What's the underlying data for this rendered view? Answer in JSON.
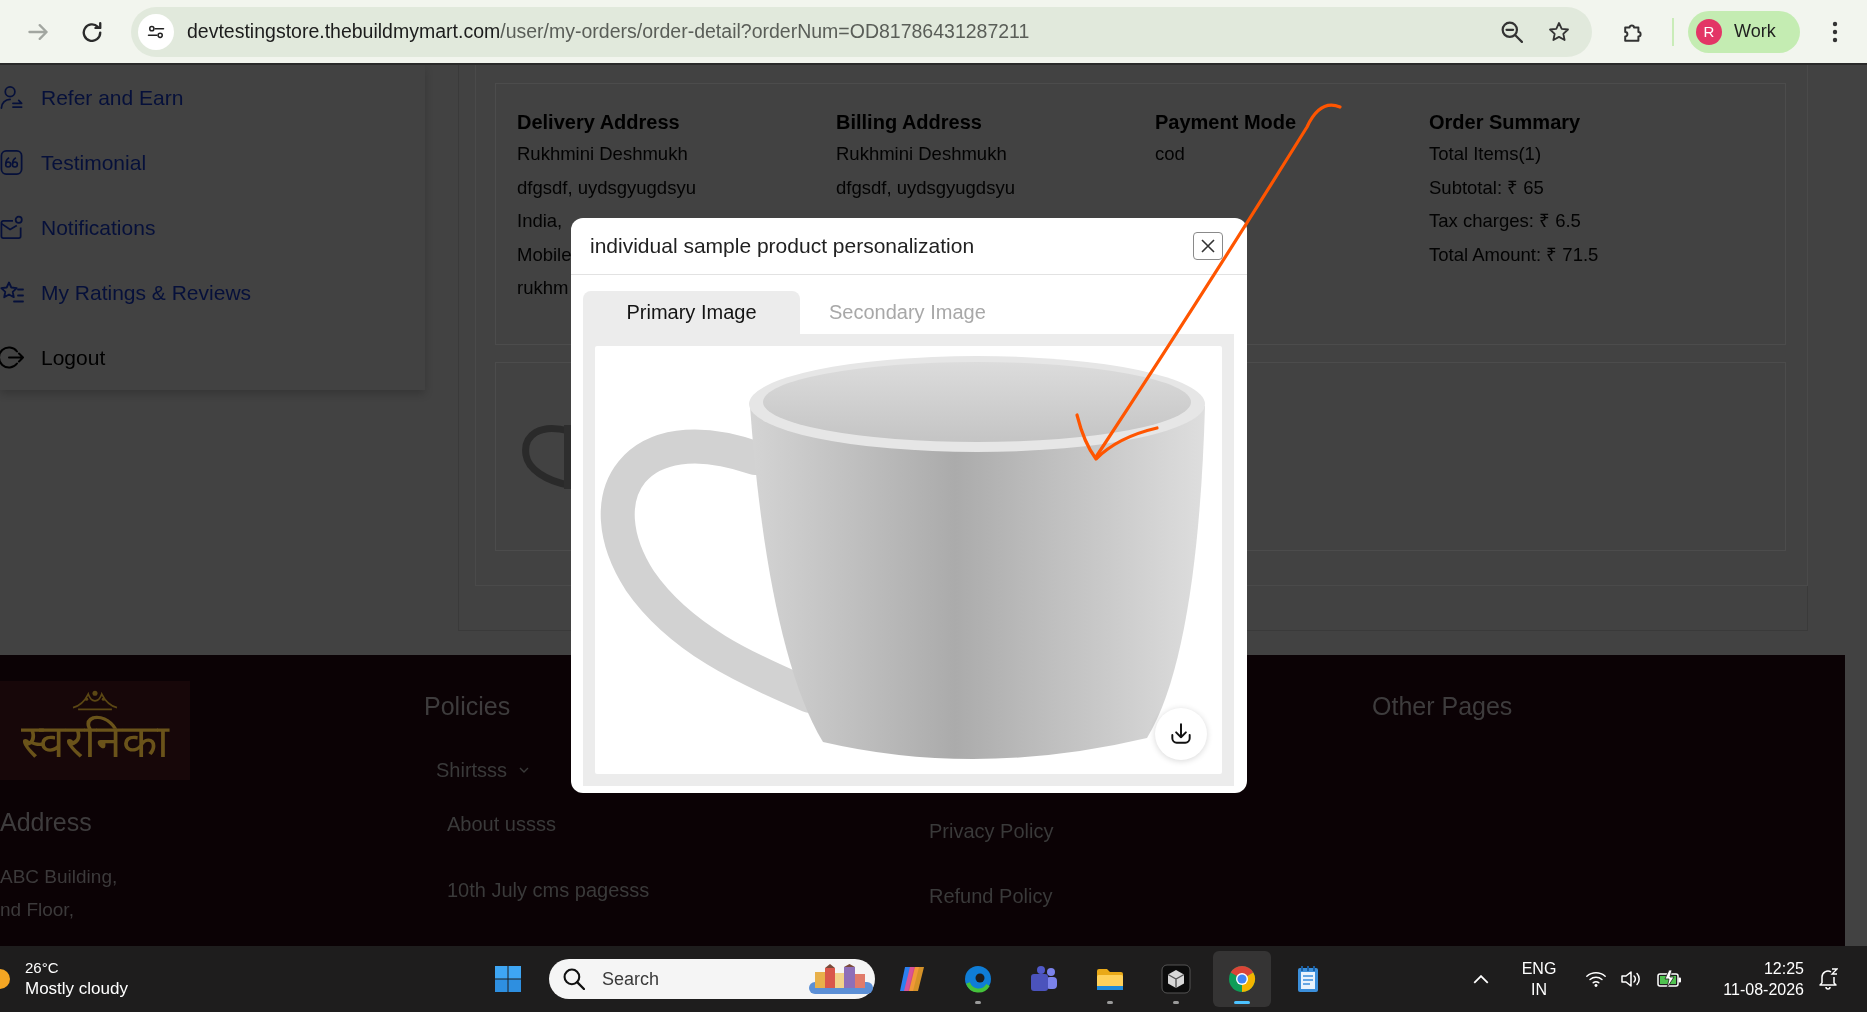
{
  "browser": {
    "forward": {
      "disabled": true
    },
    "url": {
      "host": "devtestingstore.thebuildmymart.com",
      "path": "/user/my-orders/order-detail?orderNum=OD81786431287211"
    },
    "profile": {
      "initial": "R",
      "label": "Work"
    }
  },
  "sidebar": {
    "items": [
      {
        "label": "Refer and Earn",
        "kind": "link"
      },
      {
        "label": "Testimonial",
        "kind": "link"
      },
      {
        "label": "Notifications",
        "kind": "link"
      },
      {
        "label": "My Ratings & Reviews",
        "kind": "link"
      },
      {
        "label": "Logout",
        "kind": "action"
      }
    ]
  },
  "order_details": {
    "columns": [
      {
        "heading": "Delivery Address",
        "lines": [
          "Rukhmini Deshmukh",
          "dfgsdf, uydsgyugdsyu",
          "India,",
          "Mobile",
          "rukhm"
        ]
      },
      {
        "heading": "Billing Address",
        "lines": [
          "Rukhmini Deshmukh",
          "dfgsdf, uydsgyugdsyu"
        ]
      },
      {
        "heading": "Payment Mode",
        "lines": [
          "cod"
        ]
      },
      {
        "heading": "Order Summary",
        "lines": [
          "Total Items(1)",
          "Subtotal: ₹ 65",
          "Tax charges: ₹ 6.5",
          "Total Amount: ₹ 71.5"
        ]
      }
    ]
  },
  "modal": {
    "title": "individual sample product personalization",
    "tabs": [
      {
        "label": "Primary Image",
        "selected": true
      },
      {
        "label": "Secondary Image",
        "selected": false
      }
    ]
  },
  "footer": {
    "logo": "स्वरनिका",
    "address": {
      "heading": "Address",
      "lines": [
        "ABC Building,",
        "nd Floor,"
      ]
    },
    "sections": [
      {
        "heading": "Policies",
        "links": [
          {
            "label": "Shirtsss",
            "kind": "dropdown"
          },
          {
            "label": "About ussss",
            "kind": "link"
          },
          {
            "label": "10th July cms pagesss",
            "kind": "link"
          }
        ]
      },
      {
        "links": [
          {
            "label": "Privacy Policy",
            "kind": "link"
          },
          {
            "label": "Refund Policy",
            "kind": "link"
          }
        ]
      },
      {
        "heading": "Other Pages"
      }
    ]
  },
  "taskbar": {
    "weather": {
      "temperature": "26°C",
      "condition": "Mostly cloudy"
    },
    "search": {
      "placeholder": "Search"
    },
    "apps": [
      {
        "running": false,
        "selected": false
      },
      {
        "running": true,
        "selected": false
      },
      {
        "running": false,
        "selected": false
      },
      {
        "running": true,
        "selected": false
      },
      {
        "running": true,
        "selected": false
      },
      {
        "running": true,
        "selected": true
      },
      {
        "running": false,
        "selected": false
      }
    ],
    "language": [
      "ENG",
      "IN"
    ],
    "clock": {
      "time": "12:25",
      "date": "11-08-2026"
    }
  }
}
